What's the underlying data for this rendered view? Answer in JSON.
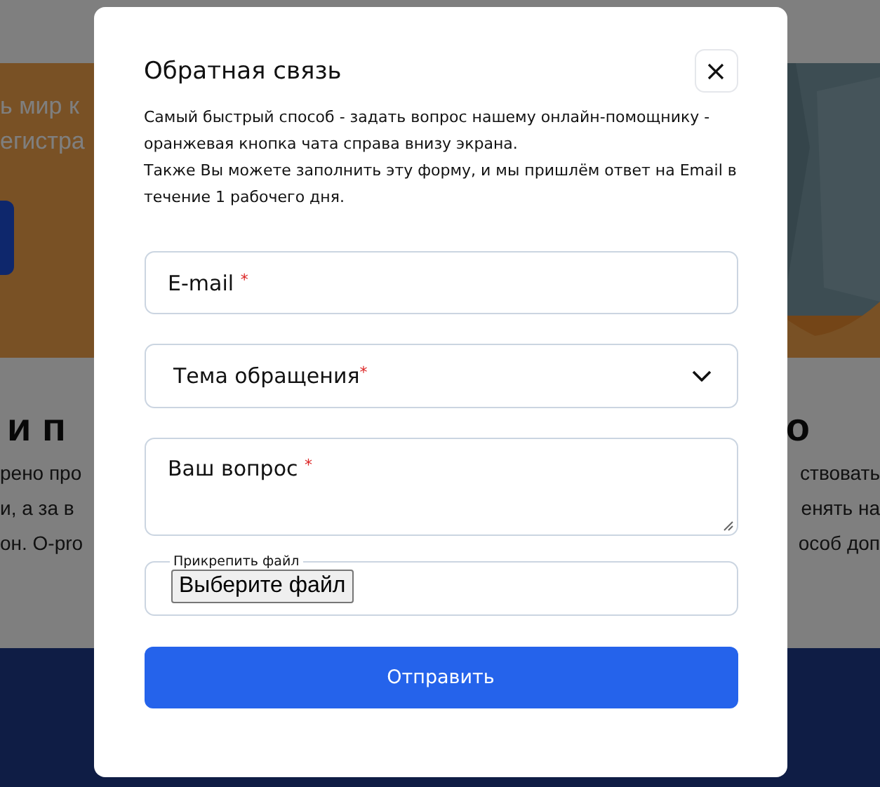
{
  "background": {
    "hero_lines": [
      "ь мир к",
      "егистра"
    ],
    "heading_left": "и п",
    "heading_right": "о",
    "text_left": [
      "рено про",
      "и, а за в",
      "он. O-pro"
    ],
    "text_right": [
      "ствовать",
      "енять на",
      "особ доп"
    ]
  },
  "modal": {
    "title": "Обратная связь",
    "description": [
      "Самый быстрый способ - задать вопрос нашему онлайн-помощнику - оранжевая кнопка чата справа внизу экрана.",
      "Также Вы можете заполнить эту форму, и мы пришлём ответ на Email в течение 1 рабочего дня."
    ],
    "fields": [
      {
        "kind": "input",
        "label": "E-mail",
        "mark": "*"
      },
      {
        "kind": "select",
        "label": "Тема обращения",
        "mark": "*"
      },
      {
        "kind": "textarea",
        "label": "Ваш вопрос",
        "mark": "*"
      }
    ],
    "file": {
      "legend": "Прикрепить файл",
      "button": "Выберите файл"
    },
    "submit": "Отправить"
  }
}
